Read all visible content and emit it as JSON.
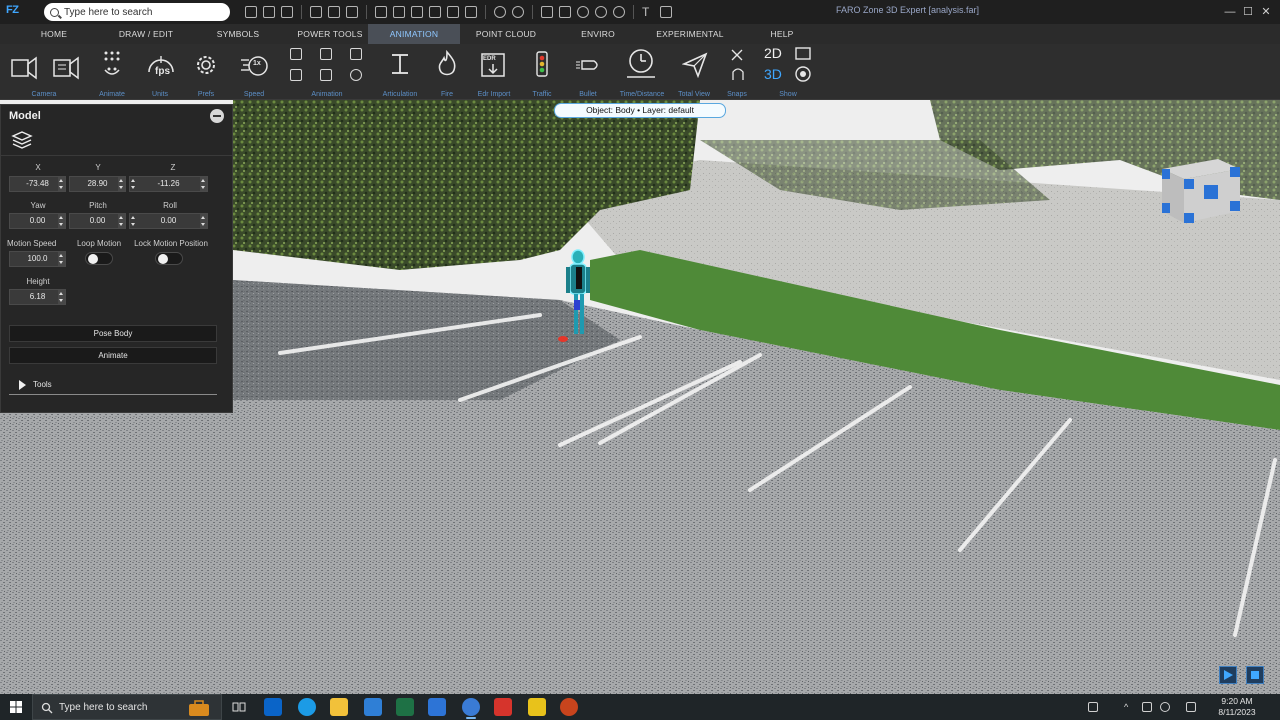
{
  "window": {
    "app_logo": "FZ",
    "search_placeholder": "Type here to search",
    "title": "FARO Zone 3D Expert [analysis.far]",
    "minimize": "—",
    "maximize": "☐",
    "close": "✕"
  },
  "menu_tabs": [
    {
      "label": "HOME"
    },
    {
      "label": "DRAW / EDIT"
    },
    {
      "label": "SYMBOLS"
    },
    {
      "label": "POWER TOOLS"
    },
    {
      "label": "ANIMATION"
    },
    {
      "label": "POINT CLOUD"
    },
    {
      "label": "ENVIRO"
    },
    {
      "label": "EXPERIMENTAL"
    },
    {
      "label": "HELP"
    }
  ],
  "active_tab": "ANIMATION",
  "ribbon": {
    "groups": [
      {
        "label": "Camera",
        "icon": "camera-icon"
      },
      {
        "label": "Animate",
        "icon": "animate-icon"
      },
      {
        "label": "Units",
        "icon": "fps-icon"
      },
      {
        "label": "Prefs",
        "icon": "gear-icon"
      },
      {
        "label": "Speed",
        "icon": "speed-icon"
      },
      {
        "label": "Animation",
        "icon": "animation-controls-icon"
      },
      {
        "label": "Articulation",
        "icon": "articulation-icon"
      },
      {
        "label": "Fire",
        "icon": "fire-icon"
      },
      {
        "label": "Edr Import",
        "icon": "edr-import-icon"
      },
      {
        "label": "Traffic",
        "icon": "traffic-light-icon"
      },
      {
        "label": "Bullet",
        "icon": "bullet-icon"
      },
      {
        "label": "Time/Distance",
        "icon": "clock-icon"
      },
      {
        "label": "Total View",
        "icon": "paper-plane-icon"
      },
      {
        "label": "Snaps",
        "icon": "snaps-icon"
      },
      {
        "label": "Show",
        "icon": "show-icon"
      }
    ],
    "fps_text": "fps",
    "speed_text": "1x",
    "edr_text": "EDR",
    "show_2d": "2D",
    "show_3d": "3D"
  },
  "tooltip": {
    "text": "Object: Body  •  Layer: default"
  },
  "model_panel": {
    "title": "Model",
    "x_label": "X",
    "y_label": "Y",
    "z_label": "Z",
    "x_value": "-73.48",
    "y_value": "28.90",
    "z_value": "-11.26",
    "yaw_label": "Yaw",
    "pitch_label": "Pitch",
    "roll_label": "Roll",
    "yaw_value": "0.00",
    "pitch_value": "0.00",
    "roll_value": "0.00",
    "motion_speed_label": "Motion Speed",
    "loop_motion_label": "Loop Motion",
    "lock_motion_label": "Lock Motion Position",
    "motion_speed_value": "100.0",
    "loop_motion_on": false,
    "lock_motion_on": false,
    "height_label": "Height",
    "height_value": "6.18",
    "pose_body_button": "Pose Body",
    "animate_button": "Animate",
    "tools_label": "Tools"
  },
  "taskbar": {
    "search_placeholder": "Type here to search",
    "time": "9:20 AM",
    "date": "8/11/2023",
    "apps": [
      {
        "name": "outlook-icon",
        "color": "#0a64c8"
      },
      {
        "name": "edge-icon",
        "color": "#1c9be6"
      },
      {
        "name": "file-explorer-icon",
        "color": "#f2c13a"
      },
      {
        "name": "app-cube-icon",
        "color": "#2f7fd6"
      },
      {
        "name": "excel-icon",
        "color": "#1e7145"
      },
      {
        "name": "r-app-icon",
        "color": "#2d74d6"
      },
      {
        "name": "faro-zone-icon",
        "color": "#3a7bd5"
      },
      {
        "name": "red-app-icon",
        "color": "#d6342c"
      },
      {
        "name": "warning-app-icon",
        "color": "#e8c21b"
      },
      {
        "name": "powerpoint-icon",
        "color": "#c8441d"
      }
    ]
  },
  "colors": {
    "accent": "#8fc7ff",
    "ribbon_label": "#5c8fc7",
    "tooltip_border": "#59a7df",
    "playback": "#3f7fbf"
  }
}
